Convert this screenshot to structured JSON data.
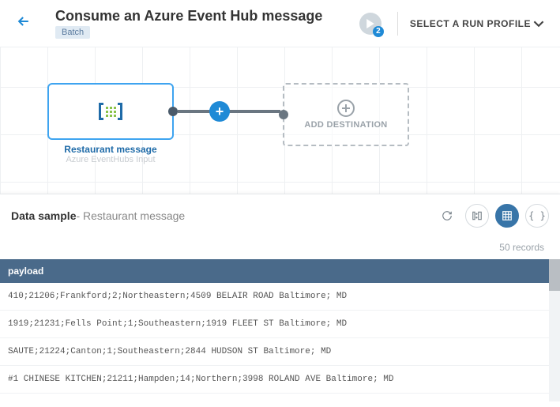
{
  "header": {
    "title": "Consume an Azure Event Hub message",
    "badge": "Batch",
    "run_badge": "2",
    "run_profile": "SELECT A RUN PROFILE"
  },
  "canvas": {
    "source": {
      "label": "Restaurant message",
      "sublabel": "Azure EventHubs Input"
    },
    "destination": {
      "label": "ADD DESTINATION"
    }
  },
  "panel": {
    "title": "Data sample",
    "subtitle": " - Restaurant message",
    "records": "50 records",
    "column": "payload",
    "rows": [
      "410;21206;Frankford;2;Northeastern;4509 BELAIR ROAD Baltimore; MD",
      "1919;21231;Fells Point;1;Southeastern;1919 FLEET ST Baltimore; MD",
      "SAUTE;21224;Canton;1;Southeastern;2844 HUDSON ST Baltimore; MD",
      "#1 CHINESE KITCHEN;21211;Hampden;14;Northern;3998 ROLAND AVE Baltimore; MD"
    ]
  }
}
